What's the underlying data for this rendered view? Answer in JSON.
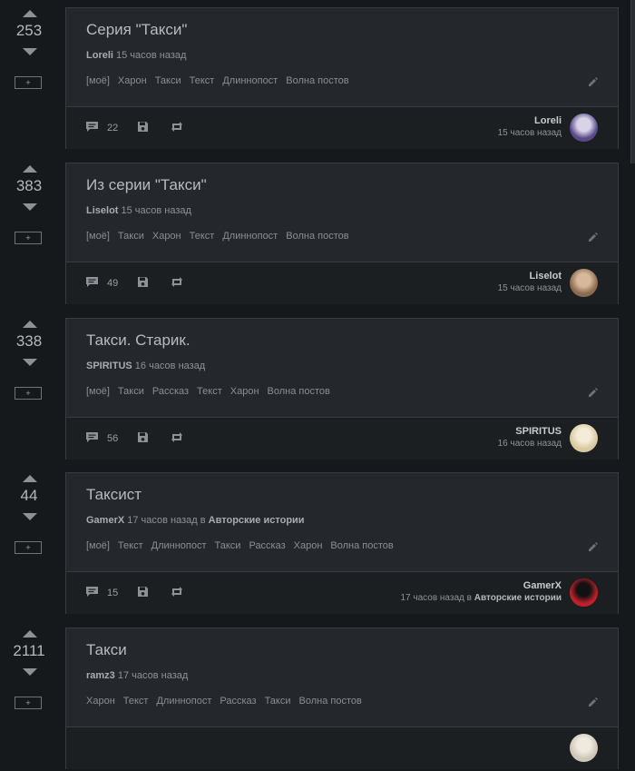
{
  "posts": [
    {
      "rating": "253",
      "plus": "+",
      "title": "Серия \"Такси\"",
      "author": "Loreli",
      "time": "15 часов назад",
      "community_prefix": "",
      "community": "",
      "tags": [
        "[моё]",
        "Харон",
        "Такси",
        "Текст",
        "Длиннопост",
        "Волна постов"
      ],
      "comments": "22",
      "avatar_colors": [
        "#5b4a87",
        "#d8d4e8"
      ]
    },
    {
      "rating": "383",
      "plus": "+",
      "title": "Из серии \"Такси\"",
      "author": "Liselot",
      "time": "15 часов назад",
      "community_prefix": "",
      "community": "",
      "tags": [
        "[моё]",
        "Такси",
        "Харон",
        "Текст",
        "Длиннопост",
        "Волна постов"
      ],
      "comments": "49",
      "avatar_colors": [
        "#8c6a52",
        "#d6b89a"
      ]
    },
    {
      "rating": "338",
      "plus": "+",
      "title": "Такси. Старик.",
      "author": "SPIRITUS",
      "time": "16 часов назад",
      "community_prefix": "",
      "community": "",
      "tags": [
        "[моё]",
        "Такси",
        "Рассказ",
        "Текст",
        "Харон",
        "Волна постов"
      ],
      "comments": "56",
      "avatar_colors": [
        "#d9c9a0",
        "#f4ecd8"
      ]
    },
    {
      "rating": "44",
      "plus": "+",
      "title": "Таксист",
      "author": "GamerX",
      "time": "17 часов назад",
      "community_prefix": " в ",
      "community": "Авторские истории",
      "tags": [
        "[моё]",
        "Текст",
        "Длиннопост",
        "Такси",
        "Рассказ",
        "Харон",
        "Волна постов"
      ],
      "comments": "15",
      "avatar_colors": [
        "#c0202a",
        "#111111"
      ]
    },
    {
      "rating": "2111",
      "plus": "+",
      "title": "Такси",
      "author": "ramz3",
      "time": "17 часов назад",
      "community_prefix": "",
      "community": "",
      "tags": [
        "Харон",
        "Текст",
        "Длиннопост",
        "Рассказ",
        "Такси",
        "Волна постов"
      ],
      "comments": "",
      "avatar_colors": [
        "#cfc6b8",
        "#efe9df"
      ]
    }
  ],
  "icons": {
    "upvote": "upvote-arrow-icon",
    "downvote": "downvote-arrow-icon",
    "comments": "comment-icon",
    "save": "save-floppy-icon",
    "share": "repost-icon",
    "edit": "pencil-icon"
  }
}
